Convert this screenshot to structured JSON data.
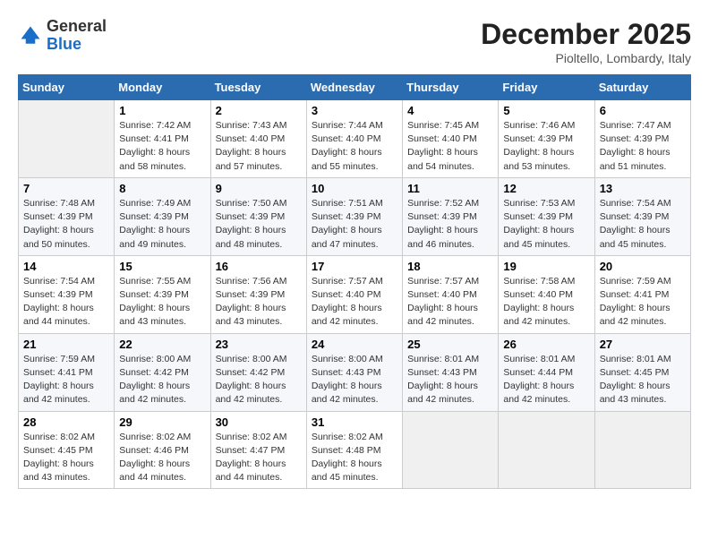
{
  "header": {
    "logo_general": "General",
    "logo_blue": "Blue",
    "month": "December 2025",
    "location": "Pioltello, Lombardy, Italy"
  },
  "days_of_week": [
    "Sunday",
    "Monday",
    "Tuesday",
    "Wednesday",
    "Thursday",
    "Friday",
    "Saturday"
  ],
  "weeks": [
    [
      {
        "day": "",
        "info": ""
      },
      {
        "day": "1",
        "info": "Sunrise: 7:42 AM\nSunset: 4:41 PM\nDaylight: 8 hours\nand 58 minutes."
      },
      {
        "day": "2",
        "info": "Sunrise: 7:43 AM\nSunset: 4:40 PM\nDaylight: 8 hours\nand 57 minutes."
      },
      {
        "day": "3",
        "info": "Sunrise: 7:44 AM\nSunset: 4:40 PM\nDaylight: 8 hours\nand 55 minutes."
      },
      {
        "day": "4",
        "info": "Sunrise: 7:45 AM\nSunset: 4:40 PM\nDaylight: 8 hours\nand 54 minutes."
      },
      {
        "day": "5",
        "info": "Sunrise: 7:46 AM\nSunset: 4:39 PM\nDaylight: 8 hours\nand 53 minutes."
      },
      {
        "day": "6",
        "info": "Sunrise: 7:47 AM\nSunset: 4:39 PM\nDaylight: 8 hours\nand 51 minutes."
      }
    ],
    [
      {
        "day": "7",
        "info": "Sunrise: 7:48 AM\nSunset: 4:39 PM\nDaylight: 8 hours\nand 50 minutes."
      },
      {
        "day": "8",
        "info": "Sunrise: 7:49 AM\nSunset: 4:39 PM\nDaylight: 8 hours\nand 49 minutes."
      },
      {
        "day": "9",
        "info": "Sunrise: 7:50 AM\nSunset: 4:39 PM\nDaylight: 8 hours\nand 48 minutes."
      },
      {
        "day": "10",
        "info": "Sunrise: 7:51 AM\nSunset: 4:39 PM\nDaylight: 8 hours\nand 47 minutes."
      },
      {
        "day": "11",
        "info": "Sunrise: 7:52 AM\nSunset: 4:39 PM\nDaylight: 8 hours\nand 46 minutes."
      },
      {
        "day": "12",
        "info": "Sunrise: 7:53 AM\nSunset: 4:39 PM\nDaylight: 8 hours\nand 45 minutes."
      },
      {
        "day": "13",
        "info": "Sunrise: 7:54 AM\nSunset: 4:39 PM\nDaylight: 8 hours\nand 45 minutes."
      }
    ],
    [
      {
        "day": "14",
        "info": "Sunrise: 7:54 AM\nSunset: 4:39 PM\nDaylight: 8 hours\nand 44 minutes."
      },
      {
        "day": "15",
        "info": "Sunrise: 7:55 AM\nSunset: 4:39 PM\nDaylight: 8 hours\nand 43 minutes."
      },
      {
        "day": "16",
        "info": "Sunrise: 7:56 AM\nSunset: 4:39 PM\nDaylight: 8 hours\nand 43 minutes."
      },
      {
        "day": "17",
        "info": "Sunrise: 7:57 AM\nSunset: 4:40 PM\nDaylight: 8 hours\nand 42 minutes."
      },
      {
        "day": "18",
        "info": "Sunrise: 7:57 AM\nSunset: 4:40 PM\nDaylight: 8 hours\nand 42 minutes."
      },
      {
        "day": "19",
        "info": "Sunrise: 7:58 AM\nSunset: 4:40 PM\nDaylight: 8 hours\nand 42 minutes."
      },
      {
        "day": "20",
        "info": "Sunrise: 7:59 AM\nSunset: 4:41 PM\nDaylight: 8 hours\nand 42 minutes."
      }
    ],
    [
      {
        "day": "21",
        "info": "Sunrise: 7:59 AM\nSunset: 4:41 PM\nDaylight: 8 hours\nand 42 minutes."
      },
      {
        "day": "22",
        "info": "Sunrise: 8:00 AM\nSunset: 4:42 PM\nDaylight: 8 hours\nand 42 minutes."
      },
      {
        "day": "23",
        "info": "Sunrise: 8:00 AM\nSunset: 4:42 PM\nDaylight: 8 hours\nand 42 minutes."
      },
      {
        "day": "24",
        "info": "Sunrise: 8:00 AM\nSunset: 4:43 PM\nDaylight: 8 hours\nand 42 minutes."
      },
      {
        "day": "25",
        "info": "Sunrise: 8:01 AM\nSunset: 4:43 PM\nDaylight: 8 hours\nand 42 minutes."
      },
      {
        "day": "26",
        "info": "Sunrise: 8:01 AM\nSunset: 4:44 PM\nDaylight: 8 hours\nand 42 minutes."
      },
      {
        "day": "27",
        "info": "Sunrise: 8:01 AM\nSunset: 4:45 PM\nDaylight: 8 hours\nand 43 minutes."
      }
    ],
    [
      {
        "day": "28",
        "info": "Sunrise: 8:02 AM\nSunset: 4:45 PM\nDaylight: 8 hours\nand 43 minutes."
      },
      {
        "day": "29",
        "info": "Sunrise: 8:02 AM\nSunset: 4:46 PM\nDaylight: 8 hours\nand 44 minutes."
      },
      {
        "day": "30",
        "info": "Sunrise: 8:02 AM\nSunset: 4:47 PM\nDaylight: 8 hours\nand 44 minutes."
      },
      {
        "day": "31",
        "info": "Sunrise: 8:02 AM\nSunset: 4:48 PM\nDaylight: 8 hours\nand 45 minutes."
      },
      {
        "day": "",
        "info": ""
      },
      {
        "day": "",
        "info": ""
      },
      {
        "day": "",
        "info": ""
      }
    ]
  ]
}
